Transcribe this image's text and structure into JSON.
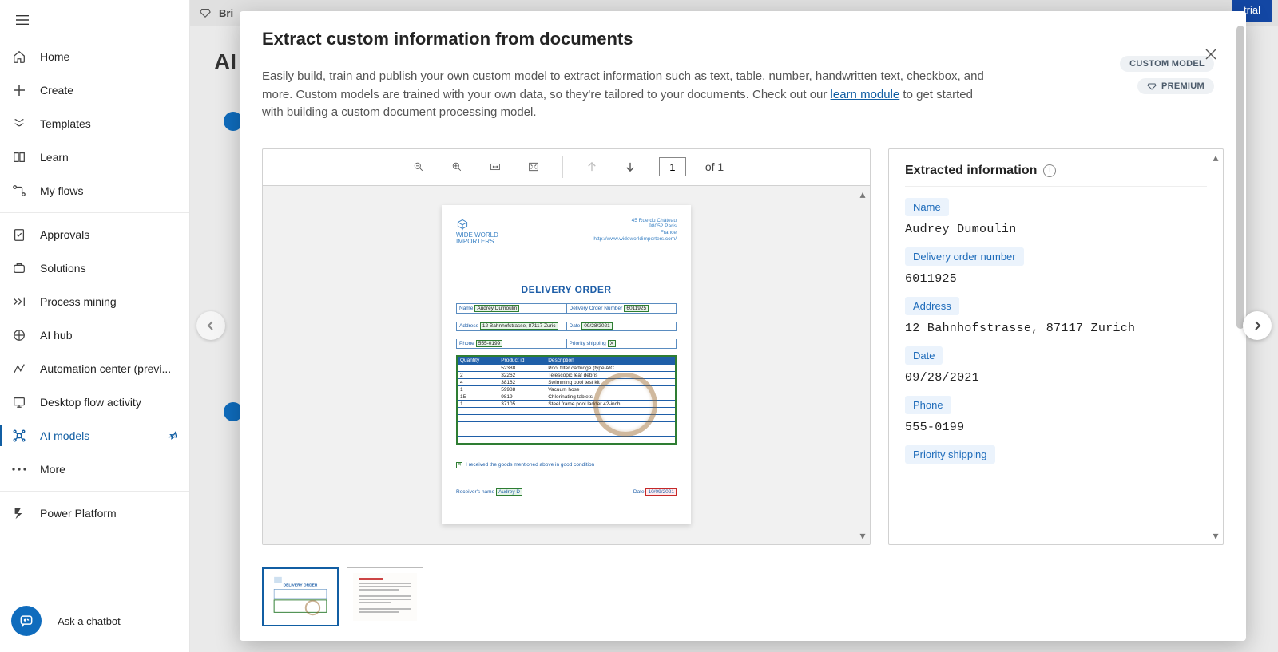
{
  "nav": {
    "brand_fragment": "Bri",
    "trial_button": "trial",
    "items": [
      {
        "label": "Home"
      },
      {
        "label": "Create"
      },
      {
        "label": "Templates"
      },
      {
        "label": "Learn"
      },
      {
        "label": "My flows"
      }
    ],
    "items_group2": [
      {
        "label": "Approvals"
      },
      {
        "label": "Solutions"
      },
      {
        "label": "Process mining"
      },
      {
        "label": "AI hub"
      },
      {
        "label": "Automation center (previ..."
      },
      {
        "label": "Desktop flow activity"
      },
      {
        "label": "AI models"
      },
      {
        "label": "More"
      }
    ],
    "power_platform": "Power Platform",
    "chatbot": "Ask a chatbot"
  },
  "bg": {
    "page_title_fragment": "AI"
  },
  "modal": {
    "title": "Extract custom information from documents",
    "desc_pre": "Easily build, train and publish your own custom model to extract information such as text, table, number, handwritten text, checkbox, and more. Custom models are trained with your own data, so they're tailored to your documents. Check out our ",
    "learn_link": "learn module",
    "desc_post": " to get started with building a custom document processing model.",
    "pill_custom": "CUSTOM MODEL",
    "pill_premium": "PREMIUM",
    "toolbar": {
      "page_value": "1",
      "page_of": "of 1"
    },
    "extracted": {
      "header": "Extracted information",
      "fields": [
        {
          "tag": "Name",
          "value": "Audrey Dumoulin"
        },
        {
          "tag": "Delivery order number",
          "value": "6011925"
        },
        {
          "tag": "Address",
          "value": "12 Bahnhofstrasse, 87117 Zurich"
        },
        {
          "tag": "Date",
          "value": "09/28/2021"
        },
        {
          "tag": "Phone",
          "value": "555-0199"
        },
        {
          "tag": "Priority shipping",
          "value": ""
        }
      ]
    },
    "document": {
      "company_line1": "WIDE WORLD",
      "company_line2": "IMPORTERS",
      "addr1": "45 Rue du Château",
      "addr2": "98052 Paris",
      "addr3": "France",
      "addr4": "http://www.wideworldimporters.com/",
      "title": "DELIVERY ORDER",
      "labels": {
        "name": "Name",
        "don": "Delivery Order Number",
        "address": "Address",
        "date": "Date",
        "phone": "Phone",
        "priority": "Priority shipping"
      },
      "values": {
        "name": "Audrey Dumoulin",
        "don": "6011925",
        "address": "12 Bahnhofstrasse, 87117 Zuric",
        "date": "09/28/2021",
        "phone": "555-0199",
        "priority": "X"
      },
      "columns": [
        "Quantity",
        "Product id",
        "Description"
      ],
      "rows": [
        [
          "",
          "52388",
          "Pool filter cartridge (type A/C"
        ],
        [
          "2",
          "32262",
          "Telescopic leaf debris"
        ],
        [
          "4",
          "38162",
          "Swimming pool test kit"
        ],
        [
          "1",
          "59988",
          "Vacuum hose"
        ],
        [
          "15",
          "9819",
          "Chlorinating tablets"
        ],
        [
          "1",
          "37105",
          "Steel frame pool ladder 42-inch"
        ]
      ],
      "ack": "I received the goods mentioned above in good condition",
      "recv_label": "Receiver's name",
      "recv_val": "Audrey D",
      "sign_date_label": "Date",
      "sign_date_val": "10/09/2021"
    }
  }
}
